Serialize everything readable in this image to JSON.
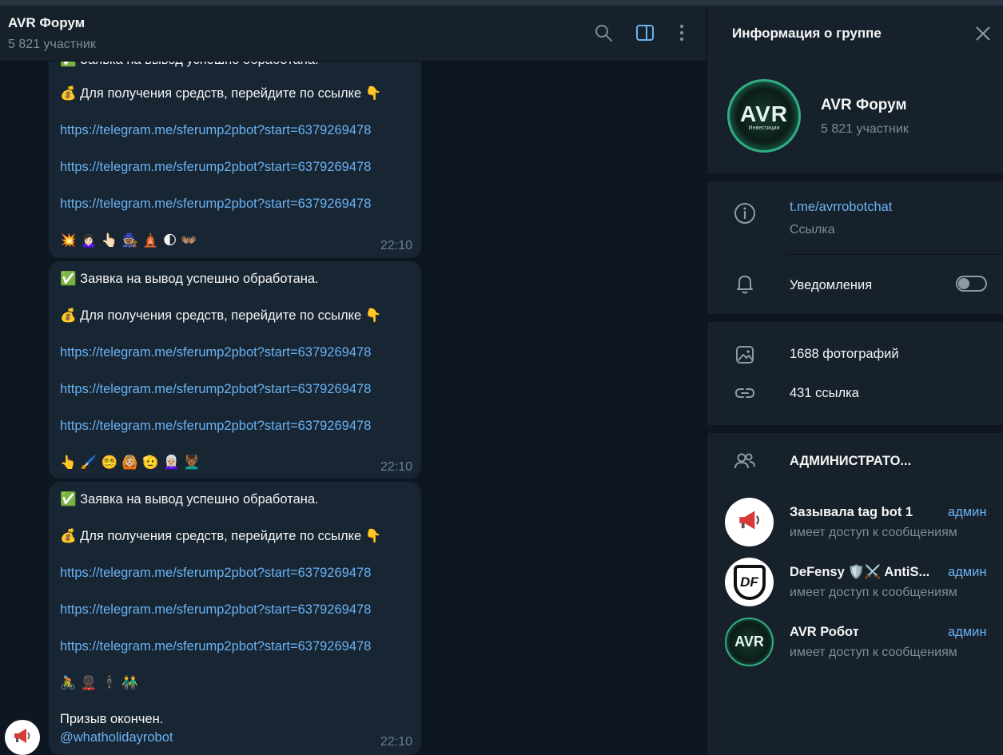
{
  "chat": {
    "title": "AVR Форум",
    "subtitle": "5 821 участник"
  },
  "messages": [
    {
      "partial_top": "✅ Заявка на вывод успешно обработана.",
      "money_line": "💰 Для получения средств, перейдите по ссылке 👇",
      "links": [
        "https://telegram.me/sferump2pbot?start=6379269478",
        "https://telegram.me/sferump2pbot?start=6379269478",
        "https://telegram.me/sferump2pbot?start=6379269478"
      ],
      "emojis": "💥 🙍🏻‍♀️ 👆🏻 🧙🏾 🛕 🌓 👐🏽",
      "time": "22:10"
    },
    {
      "status_line": "✅ Заявка на вывод успешно обработана.",
      "money_line": "💰 Для получения средств, перейдите по ссылке 👇",
      "links": [
        "https://telegram.me/sferump2pbot?start=6379269478",
        "https://telegram.me/sferump2pbot?start=6379269478",
        "https://telegram.me/sferump2pbot?start=6379269478"
      ],
      "emojis": "👆 🖌️ 😵‍💫 🙆🏼 🫡 👩🏼‍🦳 💆🏾‍♂️",
      "time": "22:10"
    },
    {
      "status_line": "✅ Заявка на вывод успешно обработана.",
      "money_line": "💰 Для получения средств, перейдите по ссылке 👇",
      "links": [
        "https://telegram.me/sferump2pbot?start=6379269478",
        "https://telegram.me/sferump2pbot?start=6379269478",
        "https://telegram.me/sferump2pbot?start=6379269478"
      ],
      "emojis": "🚴 💂🏿 🕴🏿 👬",
      "footer_text": "Призыв окончен.",
      "footer_mention": "@whatholidayrobot",
      "time": "22:10"
    }
  ],
  "panel": {
    "title": "Информация о группе",
    "group_name": "AVR Форум",
    "group_sub": "5 821 участник",
    "avatar_text": "AVR",
    "avatar_subtext": "Инвестиции",
    "link": "t.me/avrrobotchat",
    "link_label": "Ссылка",
    "notifications_label": "Уведомления",
    "notifications_on": false,
    "photos": "1688 фотографий",
    "links_count": "431 ссылка",
    "admins_header": "АДМИНИСТРАТО...",
    "admins": [
      {
        "name": "Зазывала tag bot 1",
        "role": "админ",
        "sub": "имеет доступ к сообщениям"
      },
      {
        "name": "DeFensy 🛡️⚔️ AntiS...",
        "role": "админ",
        "sub": "имеет доступ к сообщениям",
        "avatar_text": "DF"
      },
      {
        "name": "AVR Робот",
        "role": "админ",
        "sub": "имеет доступ к сообщениям",
        "avatar_text": "AVR"
      }
    ]
  },
  "colors": {
    "accent": "#6ab3f3",
    "bubble": "#182533",
    "panel": "#17212b",
    "background": "#0e1621"
  },
  "icons": [
    "search-icon",
    "sidebar-toggle-icon",
    "more-vertical-icon",
    "close-icon",
    "info-icon",
    "bell-icon",
    "photo-icon",
    "link-icon",
    "users-icon",
    "megaphone-icon"
  ]
}
